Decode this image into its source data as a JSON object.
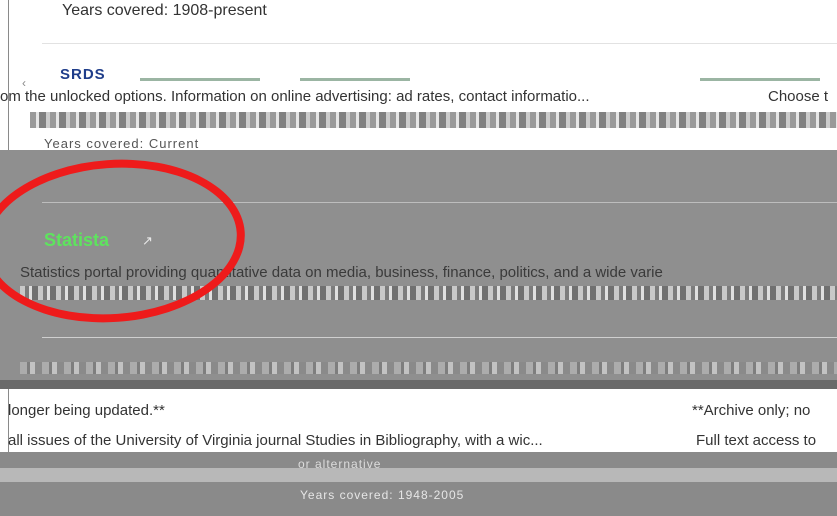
{
  "entry_top": {
    "years": "Years covered: 1908-present"
  },
  "entry_srds": {
    "title_fragment": "SRDS",
    "desc_left": "om the unlocked options. Information on online advertising: ad rates, contact informatio...",
    "desc_right": "Choose t",
    "years": "Years covered: Current"
  },
  "entry_statista": {
    "title": "Statista",
    "external_icon": "external-link-icon",
    "desc": "Statistics portal providing quantitative data on media, business, finance, politics, and a wide varie"
  },
  "lower": {
    "left_note": "longer being updated.**",
    "right_note": "**Archive only; no",
    "left_desc": "all issues of the University of Virginia journal Studies in Bibliography, with a wic...",
    "right_desc": "Full text access to",
    "garbled_1": "or alternative",
    "garbled_2": "Years covered: 1948-2005"
  },
  "colors": {
    "annotation": "#ee1b1b",
    "statista_title": "#5ee35e",
    "band": "#8f8f8f"
  }
}
